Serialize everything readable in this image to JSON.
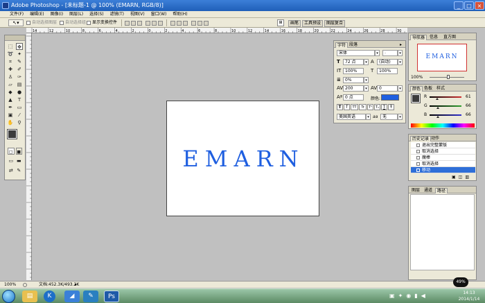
{
  "title_bar": {
    "text": "Adobe Photoshop - [未标题-1 @ 100% (EMARN, RGB/8)]",
    "minimize": "_",
    "maximize": "□",
    "close": "×"
  },
  "menu": [
    "文件(F)",
    "编辑(E)",
    "图像(I)",
    "图层(L)",
    "选择(S)",
    "滤镜(T)",
    "视图(V)",
    "窗口(W)",
    "帮助(H)"
  ],
  "options_bar": {
    "auto_select_group": "自动选择图层",
    "auto_select_layer": "自动选择组",
    "show_transform": "显示变换控件",
    "right_tabs": [
      "画笔",
      "工具预设",
      "图层复合"
    ]
  },
  "ruler_top_labels": [
    "14",
    "12",
    "10",
    "8",
    "6",
    "4",
    "2",
    "0",
    "2",
    "4",
    "6",
    "8",
    "10",
    "12",
    "14",
    "16",
    "18",
    "20",
    "22",
    "24",
    "26",
    "28",
    "30"
  ],
  "canvas": {
    "text": "EMARN",
    "text_color": "#1f5fe0"
  },
  "character_panel": {
    "tabs": [
      "字符",
      "段落"
    ],
    "font_family": "宋体",
    "font_style": "-",
    "font_size": "72 点",
    "leading": "(自动)",
    "vertical_scale": "100%",
    "horizontal_scale": "100%",
    "tracking": "0%",
    "kerning": "200",
    "baseline_shift_metric": "0",
    "baseline": "0 点",
    "color_label": "颜色:",
    "color": "#1f5fe0",
    "style_buttons": [
      "T",
      "T",
      "TT",
      "Tr",
      "T¹",
      "T₁",
      "T",
      "Ŧ"
    ],
    "language": "美国英语",
    "antialias_label": "aa",
    "antialias": "无"
  },
  "navigator_panel": {
    "tabs": [
      "导航器",
      "信息",
      "直方图"
    ],
    "preview_text": "EMARN",
    "zoom": "100%"
  },
  "color_panel": {
    "tabs": [
      "颜色",
      "色板",
      "样式"
    ],
    "channels": [
      {
        "label": "R",
        "value": "61",
        "color": "#d03030",
        "level": 0.24
      },
      {
        "label": "G",
        "value": "66",
        "color": "#30a030",
        "level": 0.26
      },
      {
        "label": "B",
        "value": "66",
        "color": "#3030d0",
        "level": 0.26
      }
    ]
  },
  "history_panel": {
    "tabs": [
      "历史记录",
      "动作"
    ],
    "items": [
      "退出完整蒙版",
      "取消选择",
      "魔棒",
      "取消选择",
      "移动"
    ],
    "selected_index": 4
  },
  "layers_panel": {
    "tabs": [
      "图层",
      "通道",
      "路径"
    ]
  },
  "status_bar": {
    "zoom": "100%",
    "doc_info": "文档:452.3K/493.2K"
  },
  "taskbar": {
    "time": "14:13",
    "date": "2014/1/14",
    "tray_badge": "49%"
  }
}
